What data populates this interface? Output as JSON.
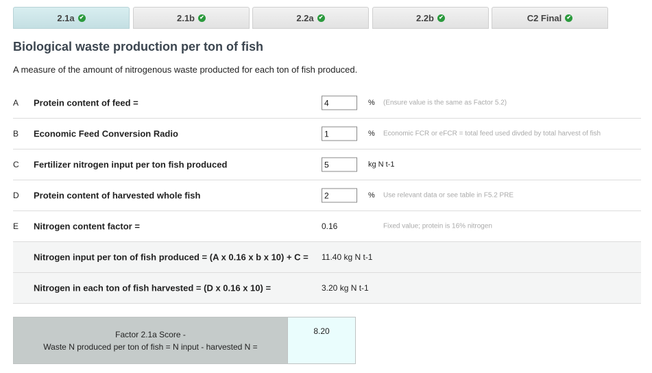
{
  "tabs": [
    {
      "label": "2.1a",
      "active": true
    },
    {
      "label": "2.1b",
      "active": false
    },
    {
      "label": "2.2a",
      "active": false
    },
    {
      "label": "2.2b",
      "active": false
    },
    {
      "label": "C2 Final",
      "active": false
    }
  ],
  "check_glyph": "✔",
  "page_title": "Biological waste production per ton of fish",
  "subtitle": "A measure of the amount of nitrogenous waste producted for each ton of fish produced.",
  "rows": [
    {
      "letter": "A",
      "label": "Protein content of feed =",
      "input_value": "4",
      "unit": "%",
      "hint": "(Ensure value is the same as Factor 5.2)"
    },
    {
      "letter": "B",
      "label": "Economic Feed Conversion Radio",
      "input_value": "1",
      "unit": "%",
      "hint": "Economic FCR or eFCR = total feed used divded by total harvest of fish"
    },
    {
      "letter": "C",
      "label": "Fertilizer nitrogen input per ton fish produced",
      "input_value": "5",
      "unit": "kg N t-1",
      "hint": ""
    },
    {
      "letter": "D",
      "label": "Protein content of harvested whole fish",
      "input_value": "2",
      "unit": "%",
      "hint": "Use relevant data or see table in F5.2 PRE"
    },
    {
      "letter": "E",
      "label": "Nitrogen content factor =",
      "value": "0.16",
      "hint": "Fixed value; protein is 16% nitrogen"
    }
  ],
  "calc_rows": [
    {
      "label": "Nitrogen input per ton of fish produced = (A x 0.16 x b x 10) + C =",
      "value": "11.40 kg N t-1"
    },
    {
      "label": "Nitrogen in each ton of fish harvested = (D x 0.16 x 10) =",
      "value": "3.20 kg N t-1"
    }
  ],
  "score": {
    "label_line1": "Factor 2.1a Score -",
    "label_line2": "Waste N produced per ton of fish = N input - harvested N =",
    "value": "8.20"
  }
}
